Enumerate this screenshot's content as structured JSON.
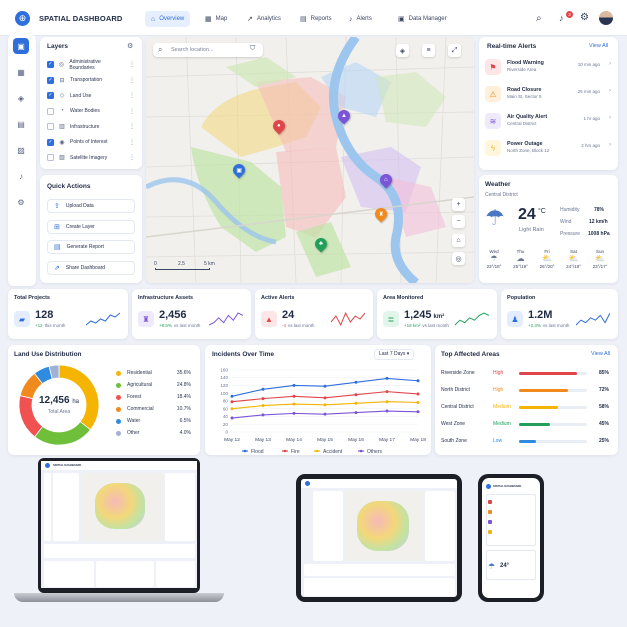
{
  "app": {
    "title": "SPATIAL DASHBOARD",
    "logo_glyph": "⊕"
  },
  "nav": [
    {
      "label": "Overview",
      "icon": "home-icon",
      "glyph": "⌂",
      "active": true
    },
    {
      "label": "Map",
      "icon": "map-icon",
      "glyph": "▦"
    },
    {
      "label": "Analytics",
      "icon": "analytics-icon",
      "glyph": "↗"
    },
    {
      "label": "Reports",
      "icon": "reports-icon",
      "glyph": "▤"
    },
    {
      "label": "Alerts",
      "icon": "bell-icon",
      "glyph": "♪"
    },
    {
      "label": "Data Manager",
      "icon": "database-icon",
      "glyph": "▣"
    }
  ],
  "header_icons": {
    "search": "⌕",
    "bell": "♪",
    "bell_badge": "3",
    "gear": "⚙"
  },
  "sidebar": [
    {
      "icon": "dashboard-icon",
      "glyph": "▣",
      "active": true
    },
    {
      "icon": "map-icon",
      "glyph": "▦"
    },
    {
      "icon": "layers-icon",
      "glyph": "◈"
    },
    {
      "icon": "table-icon",
      "glyph": "▤"
    },
    {
      "icon": "image-icon",
      "glyph": "▨"
    },
    {
      "icon": "bell-icon",
      "glyph": "♪"
    },
    {
      "icon": "gear-icon",
      "glyph": "⚙"
    }
  ],
  "layers": {
    "title": "Layers",
    "items": [
      {
        "label": "Administrative Boundaries",
        "checked": true,
        "glyph": "◎"
      },
      {
        "label": "Transportation",
        "checked": true,
        "glyph": "⊟"
      },
      {
        "label": "Land Use",
        "checked": true,
        "glyph": "◇"
      },
      {
        "label": "Water Bodies",
        "checked": false,
        "glyph": "◔"
      },
      {
        "label": "Infrastructure",
        "checked": false,
        "glyph": "▥"
      },
      {
        "label": "Points of Interest",
        "checked": true,
        "glyph": "◉"
      },
      {
        "label": "Satellite Imagery",
        "checked": false,
        "glyph": "▧"
      }
    ]
  },
  "quick_actions": {
    "title": "Quick Actions",
    "items": [
      {
        "label": "Upload Data",
        "glyph": "⇪"
      },
      {
        "label": "Create Layer",
        "glyph": "⊞"
      },
      {
        "label": "Generate Report",
        "glyph": "▤"
      },
      {
        "label": "Share Dashboard",
        "glyph": "⇗"
      }
    ]
  },
  "map": {
    "search_placeholder": "Search location...",
    "scale": {
      "a": "0",
      "b": "2.5",
      "c": "5 km"
    },
    "controls": {
      "plus": "+",
      "minus": "−",
      "home": "⌂",
      "locate": "◎"
    }
  },
  "alerts": {
    "title": "Real-time Alerts",
    "view_all": "View All",
    "items": [
      {
        "title": "Flood Warning",
        "sub": "Riverside Area",
        "time": "10 min ago",
        "glyph": "⚑",
        "color": "#e0454a",
        "bg": "#fde6e7"
      },
      {
        "title": "Road Closure",
        "sub": "Main St, Sector 5",
        "time": "25 min ago",
        "glyph": "⚠",
        "color": "#f08a1c",
        "bg": "#fff0dc"
      },
      {
        "title": "Air Quality Alert",
        "sub": "Central District",
        "time": "1 hr ago",
        "glyph": "≋",
        "color": "#7b55d6",
        "bg": "#efe9fc"
      },
      {
        "title": "Power Outage",
        "sub": "North Zone, Block 12",
        "time": "2 hrs ago",
        "glyph": "ϟ",
        "color": "#f0b41c",
        "bg": "#fff6dc"
      }
    ]
  },
  "weather": {
    "title": "Weather",
    "location": "Central District",
    "temp": "24",
    "unit": "°C",
    "condition": "Light Rain",
    "humidity_label": "Humidity",
    "humidity": "78%",
    "wind_label": "Wind",
    "wind": "12 km/h",
    "pressure_label": "Pressure",
    "pressure": "1008 hPa",
    "forecast": [
      {
        "day": "Wed",
        "range": "23°/18°",
        "glyph": "☂"
      },
      {
        "day": "Thu",
        "range": "25°/19°",
        "glyph": "☁"
      },
      {
        "day": "Fri",
        "range": "26°/20°",
        "glyph": "⛅"
      },
      {
        "day": "Sat",
        "range": "24°/18°",
        "glyph": "⛅"
      },
      {
        "day": "Sun",
        "range": "23°/17°",
        "glyph": "⛅"
      }
    ]
  },
  "kpis": [
    {
      "title": "Total Projects",
      "value": "128",
      "delta": "+12",
      "desc": "this month",
      "glyph": "▰",
      "color": "#2f6fdc",
      "bg": "#e4edff",
      "spark": [
        4,
        6,
        5,
        7,
        6,
        9,
        8,
        10
      ]
    },
    {
      "title": "Infrastructure Assets",
      "value": "2,456",
      "delta": "+8.5%",
      "desc": "vs last month",
      "glyph": "♜",
      "color": "#7b55d6",
      "bg": "#efe9fc",
      "spark": [
        5,
        6,
        8,
        6,
        9,
        7,
        10,
        9
      ]
    },
    {
      "title": "Active Alerts",
      "value": "24",
      "delta": "-4",
      "desc": "vs last month",
      "glyph": "▲",
      "color": "#e0454a",
      "bg": "#fde6e7",
      "spark": [
        6,
        8,
        5,
        9,
        6,
        8,
        7,
        9
      ]
    },
    {
      "title": "Area Monitored",
      "value": "1,245",
      "unit": "km²",
      "delta": "+18 km²",
      "desc": "vs last month",
      "glyph": "≣",
      "color": "#22a05a",
      "bg": "#e2f5ea",
      "spark": [
        4,
        6,
        5,
        7,
        6,
        8,
        9,
        8
      ]
    },
    {
      "title": "Population",
      "value": "1.2M",
      "delta": "+2.3%",
      "desc": "vs last month",
      "glyph": "♟",
      "color": "#2f6fdc",
      "bg": "#e4edff",
      "spark": [
        5,
        7,
        6,
        8,
        7,
        9,
        6,
        10
      ]
    }
  ],
  "land_use": {
    "title": "Land Use Distribution",
    "total": "12,456",
    "unit": "ha",
    "total_label": "Total Area",
    "items": [
      {
        "label": "Residential",
        "pct": "35.6%",
        "value": 35.6,
        "color": "#f5b400"
      },
      {
        "label": "Agricultural",
        "pct": "24.8%",
        "value": 24.8,
        "color": "#6fbf3a"
      },
      {
        "label": "Forest",
        "pct": "18.4%",
        "value": 18.4,
        "color": "#f05252"
      },
      {
        "label": "Commercial",
        "pct": "10.7%",
        "value": 10.7,
        "color": "#f08a1c"
      },
      {
        "label": "Water",
        "pct": "6.5%",
        "value": 6.5,
        "color": "#2f8be0"
      },
      {
        "label": "Other",
        "pct": "4.0%",
        "value": 4.0,
        "color": "#9fb2d6"
      }
    ]
  },
  "incidents": {
    "title": "Incidents Over Time",
    "range": "Last 7 Days",
    "chart_data": {
      "type": "line",
      "x": [
        "May 12",
        "May 13",
        "May 14",
        "May 15",
        "May 16",
        "May 17",
        "May 18"
      ],
      "ylim": [
        0,
        170
      ],
      "yticks": [
        0,
        20,
        40,
        60,
        80,
        100,
        120,
        140,
        160
      ],
      "series": [
        {
          "name": "Flood",
          "color": "#2f6fdc",
          "values": [
            92,
            110,
            120,
            118,
            128,
            138,
            132
          ]
        },
        {
          "name": "Fire",
          "color": "#e0454a",
          "values": [
            78,
            86,
            92,
            88,
            96,
            104,
            98
          ]
        },
        {
          "name": "Accident",
          "color": "#f5b400",
          "values": [
            60,
            68,
            72,
            70,
            74,
            78,
            76
          ]
        },
        {
          "name": "Others",
          "color": "#7b55d6",
          "values": [
            36,
            44,
            48,
            46,
            50,
            54,
            52
          ]
        }
      ]
    }
  },
  "top_areas": {
    "title": "Top Affected Areas",
    "view_all": "View All",
    "items": [
      {
        "name": "Riverside Zone",
        "level": "High",
        "pct": "85%",
        "value": 85,
        "color": "#e0454a"
      },
      {
        "name": "North District",
        "level": "High",
        "pct": "72%",
        "value": 72,
        "color": "#f08a1c"
      },
      {
        "name": "Central District",
        "level": "Medium",
        "pct": "58%",
        "value": 58,
        "color": "#f5b400"
      },
      {
        "name": "West Zone",
        "level": "Medium",
        "pct": "45%",
        "value": 45,
        "color": "#22a05a"
      },
      {
        "name": "South Zone",
        "level": "Low",
        "pct": "25%",
        "value": 25,
        "color": "#2f8be0"
      }
    ]
  },
  "mockup_labels": {
    "mini_title": "SPATIAL DASHBOARD"
  }
}
